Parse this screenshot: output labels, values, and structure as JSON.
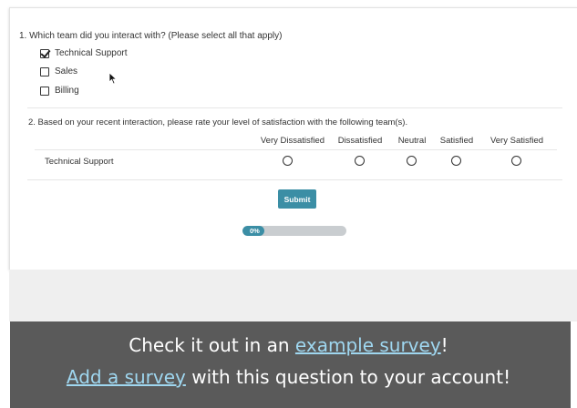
{
  "question1": {
    "title": "1. Which team did you interact with? (Please select all that apply)",
    "options": [
      {
        "label": "Technical Support",
        "checked": true
      },
      {
        "label": "Sales",
        "checked": false
      },
      {
        "label": "Billing",
        "checked": false
      }
    ]
  },
  "question2": {
    "title": "2. Based on your recent interaction, please rate your level of satisfaction with the following team(s).",
    "columns": [
      "Very Dissatisfied",
      "Dissatisfied",
      "Neutral",
      "Satisfied",
      "Very Satisfied"
    ],
    "rows": [
      "Technical Support"
    ]
  },
  "submit_label": "Submit",
  "progress": {
    "label": "0%",
    "value": 0
  },
  "banner": {
    "line1_prefix": "Check it out in an ",
    "line1_link": "example survey",
    "line1_suffix": "!",
    "line2_link": "Add a survey",
    "line2_suffix": " with this question to your account!"
  },
  "colors": {
    "accent": "#3b8ea5",
    "banner_bg": "#5a5a5a",
    "link": "#9fd7f0"
  }
}
